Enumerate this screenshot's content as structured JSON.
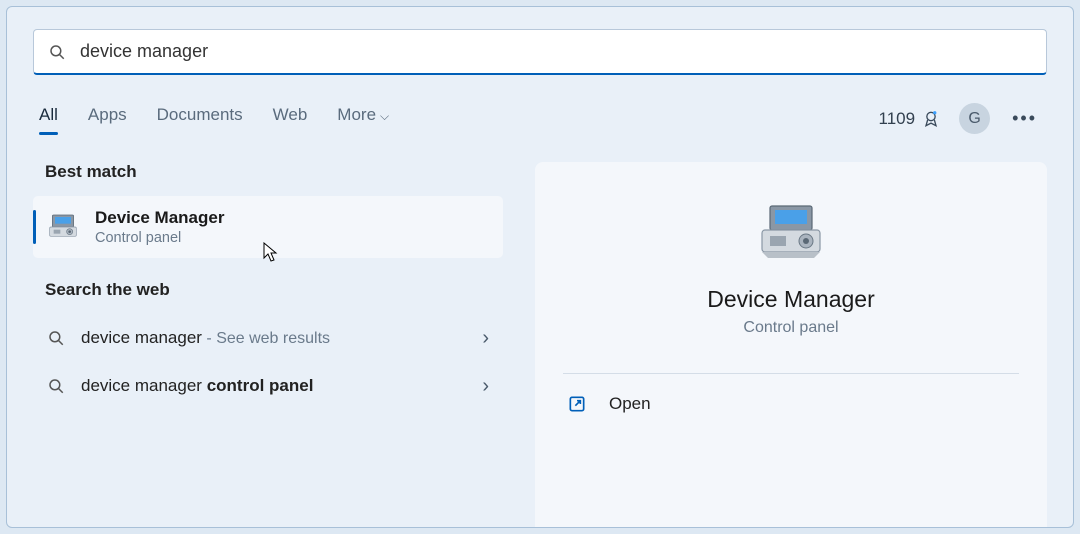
{
  "search": {
    "query": "device manager"
  },
  "tabs": {
    "all": "All",
    "apps": "Apps",
    "documents": "Documents",
    "web": "Web",
    "more": "More"
  },
  "rewards": {
    "points": "1109"
  },
  "avatar_letter": "G",
  "sections": {
    "best_match": "Best match",
    "search_web": "Search the web"
  },
  "best_match_result": {
    "title": "Device Manager",
    "subtitle": "Control panel"
  },
  "web_results": [
    {
      "label": "device manager",
      "suffix": " - See web results"
    },
    {
      "label_prefix": "device manager ",
      "label_bold": "control panel"
    }
  ],
  "detail": {
    "title": "Device Manager",
    "subtitle": "Control panel",
    "open_label": "Open"
  }
}
